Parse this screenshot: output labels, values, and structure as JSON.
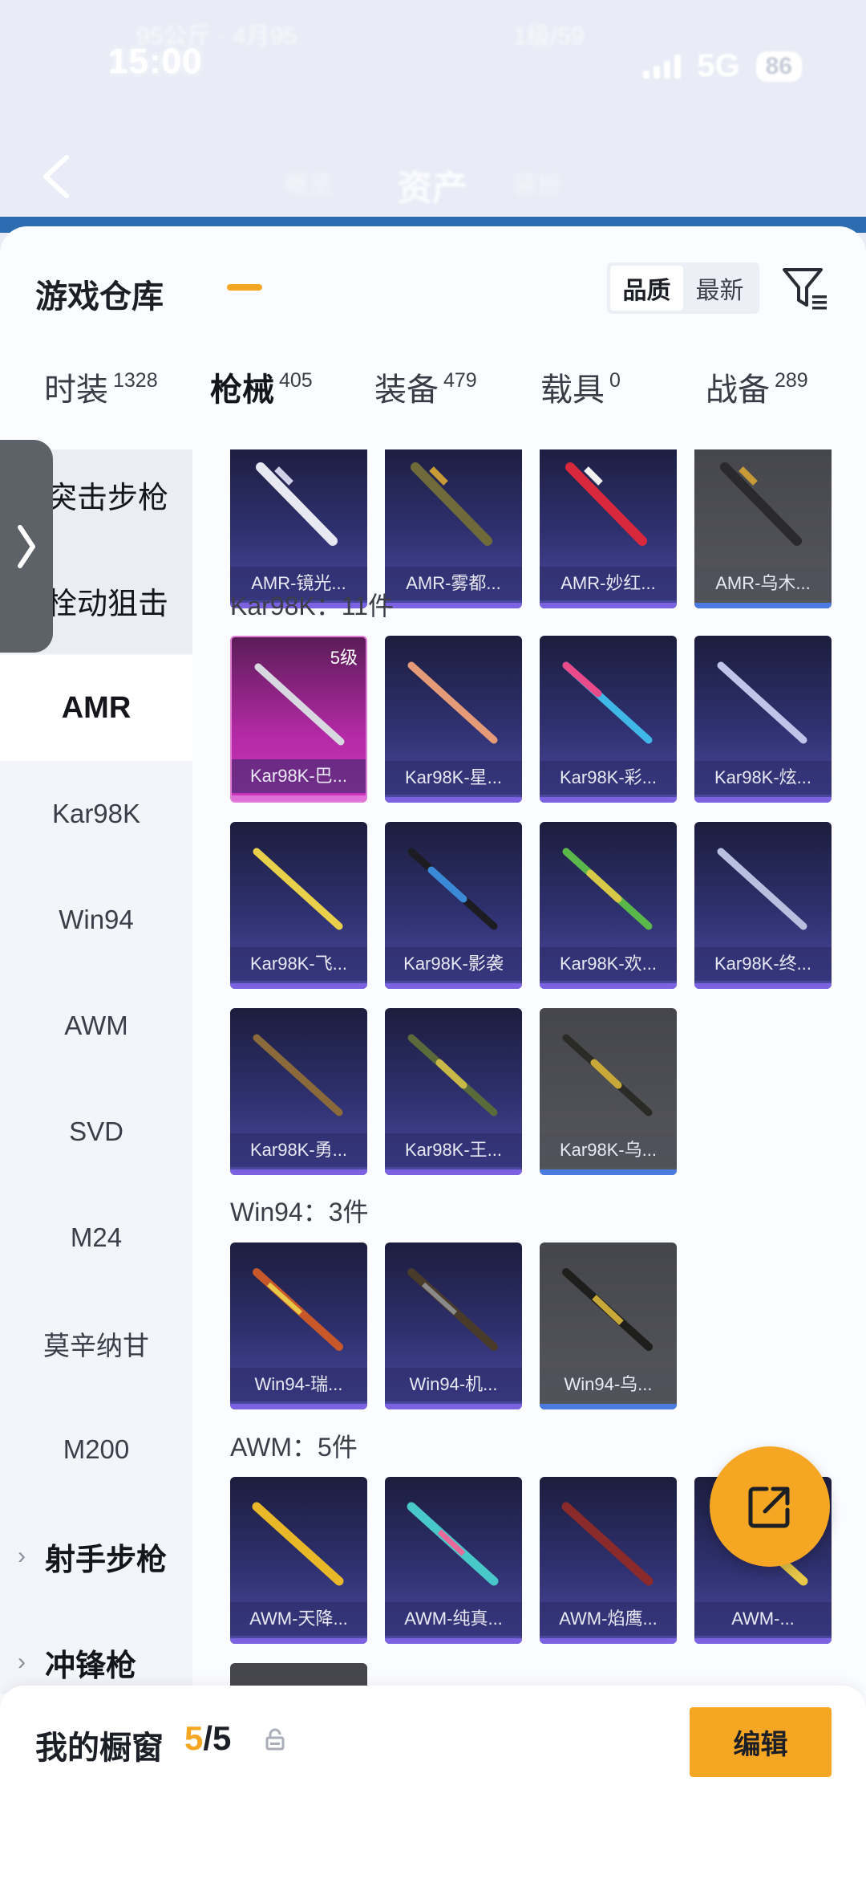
{
  "status": {
    "time": "15:00",
    "left_faint": "95公斤 · 4月95",
    "center_faint": "1级/59",
    "network": "5G",
    "battery": "86"
  },
  "topnav": {
    "title": "资产",
    "left_faint": "概览",
    "right_faint": "装扮"
  },
  "header": {
    "title": "游戏仓库",
    "sort_options": [
      "品质",
      "最新"
    ],
    "sort_selected": "品质"
  },
  "tabs": [
    {
      "label": "时装",
      "count": "1328",
      "active": false
    },
    {
      "label": "枪械",
      "count": "405",
      "active": true
    },
    {
      "label": "装备",
      "count": "479",
      "active": false
    },
    {
      "label": "载具",
      "count": "0",
      "active": false
    },
    {
      "label": "战备",
      "count": "289",
      "active": false
    }
  ],
  "sidebar": {
    "items": [
      {
        "label": "突击步枪",
        "kind": "group-dim"
      },
      {
        "label": "栓动狙击",
        "kind": "group-dim"
      },
      {
        "label": "AMR",
        "kind": "active"
      },
      {
        "label": "Kar98K",
        "kind": "item"
      },
      {
        "label": "Win94",
        "kind": "item"
      },
      {
        "label": "AWM",
        "kind": "item"
      },
      {
        "label": "SVD",
        "kind": "item"
      },
      {
        "label": "M24",
        "kind": "item"
      },
      {
        "label": "莫辛纳甘",
        "kind": "item"
      },
      {
        "label": "M200",
        "kind": "item"
      },
      {
        "label": "射手步枪",
        "kind": "group"
      },
      {
        "label": "冲锋枪",
        "kind": "group"
      }
    ]
  },
  "sections": {
    "amr": {
      "items": [
        {
          "name": "AMR-镜光...",
          "style": "purple"
        },
        {
          "name": "AMR-雾都...",
          "style": "purple"
        },
        {
          "name": "AMR-妙红...",
          "style": "purple"
        },
        {
          "name": "AMR-乌木...",
          "style": "gray"
        }
      ]
    },
    "kar98k": {
      "title": "Kar98K：11件",
      "items": [
        {
          "name": "Kar98K-巴...",
          "style": "pink",
          "level": "5级"
        },
        {
          "name": "Kar98K-星...",
          "style": "purple"
        },
        {
          "name": "Kar98K-彩...",
          "style": "purple"
        },
        {
          "name": "Kar98K-炫...",
          "style": "purple"
        },
        {
          "name": "Kar98K-飞...",
          "style": "purple"
        },
        {
          "name": "Kar98K-影袭",
          "style": "purple"
        },
        {
          "name": "Kar98K-欢...",
          "style": "purple"
        },
        {
          "name": "Kar98K-终...",
          "style": "purple"
        },
        {
          "name": "Kar98K-勇...",
          "style": "purple"
        },
        {
          "name": "Kar98K-王...",
          "style": "purple"
        },
        {
          "name": "Kar98K-乌...",
          "style": "gray"
        }
      ]
    },
    "win94": {
      "title": "Win94：3件",
      "items": [
        {
          "name": "Win94-瑞...",
          "style": "purple"
        },
        {
          "name": "Win94-机...",
          "style": "purple"
        },
        {
          "name": "Win94-乌...",
          "style": "gray"
        }
      ]
    },
    "awm": {
      "title": "AWM：5件",
      "items": [
        {
          "name": "AWM-天降...",
          "style": "purple"
        },
        {
          "name": "AWM-纯真...",
          "style": "purple"
        },
        {
          "name": "AWM-焰鹰...",
          "style": "purple"
        },
        {
          "name": "AWM-...",
          "style": "purple"
        }
      ]
    }
  },
  "showcase": {
    "label": "我的橱窗",
    "current": "5",
    "total": "/5",
    "edit_label": "编辑"
  },
  "colors": {
    "accent": "#f5a623",
    "card_purple": "#2f3170",
    "card_gray": "#56575d",
    "card_pink": "#b42aa5"
  }
}
